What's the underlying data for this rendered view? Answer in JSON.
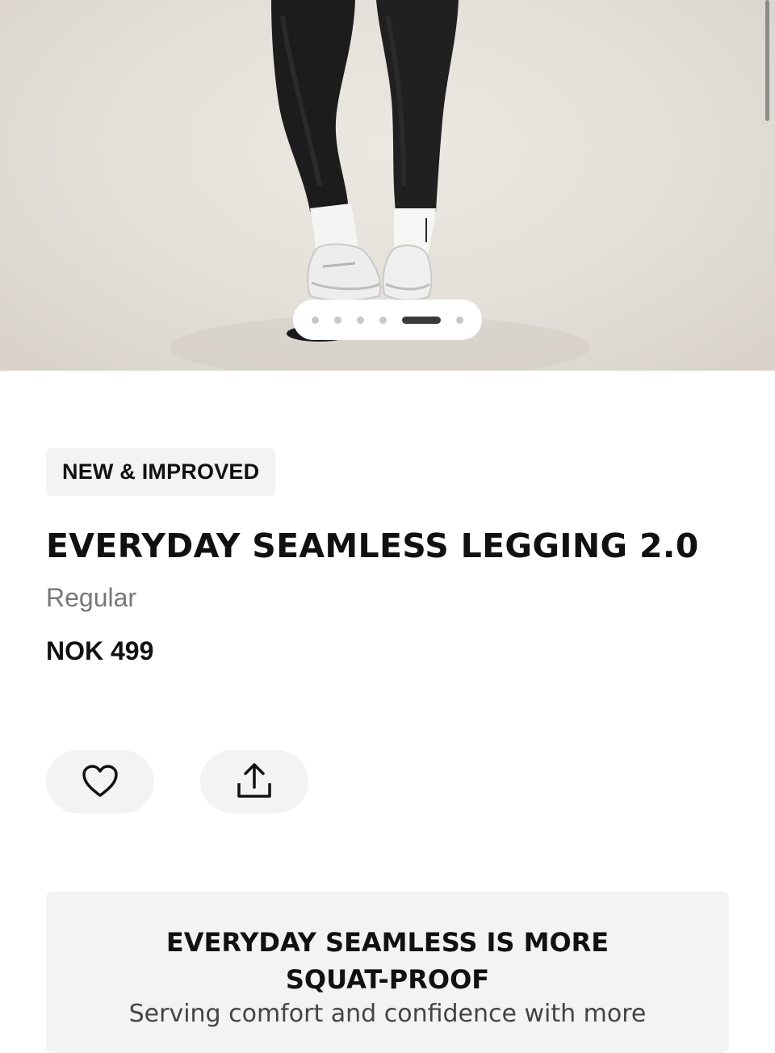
{
  "product": {
    "badge": "NEW & IMPROVED",
    "title": "EVERYDAY SEAMLESS LEGGING 2.0",
    "fit": "Regular",
    "price": "NOK 499"
  },
  "gallery": {
    "total_images": 6,
    "active_index": 4
  },
  "actions": {
    "wishlist_icon": "heart-icon",
    "share_icon": "share-icon"
  },
  "promo": {
    "heading_line1": "EVERYDAY SEAMLESS IS MORE",
    "heading_line2": "SQUAT-PROOF",
    "body": "Serving comfort and confidence with more"
  },
  "colors": {
    "text_primary": "#111111",
    "text_secondary": "#777777",
    "surface": "#f3f3f3"
  }
}
